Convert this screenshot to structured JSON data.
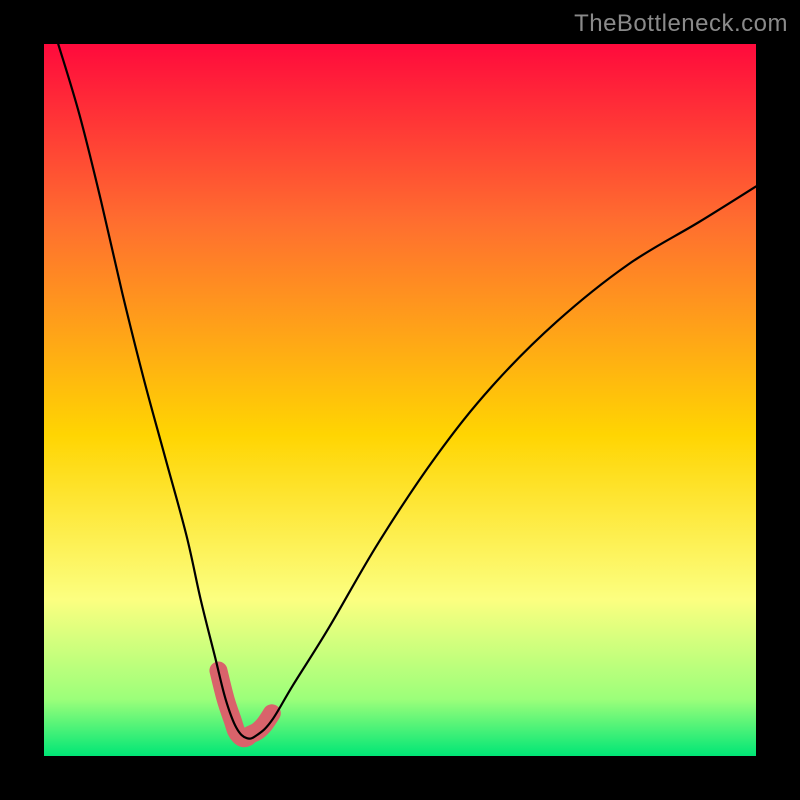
{
  "watermark": "TheBottleneck.com",
  "colors": {
    "frame": "#000000",
    "gradient_top": "#FF0A3C",
    "gradient_mid1": "#FF6E2F",
    "gradient_mid2": "#FFD502",
    "gradient_mid3": "#FCFF80",
    "gradient_bottom1": "#9CFF7A",
    "gradient_bottom2": "#00E676",
    "curve": "#000000",
    "accent": "#D9636B"
  },
  "chart_data": {
    "type": "line",
    "title": "",
    "xlabel": "",
    "ylabel": "",
    "xlim": [
      0,
      100
    ],
    "ylim": [
      0,
      100
    ],
    "categories_note": "continuous x from 0 to 100; axes unlabeled",
    "series": [
      {
        "name": "bottleneck-curve",
        "x": [
          2,
          5,
          8,
          11,
          14,
          17,
          20,
          22,
          24,
          25.5,
          27,
          28.5,
          30,
          32,
          35,
          40,
          47,
          55,
          63,
          72,
          82,
          92,
          100
        ],
        "values": [
          100,
          90,
          78,
          65,
          53,
          42,
          31,
          22,
          14,
          8,
          4,
          2.5,
          3,
          5,
          10,
          18,
          30,
          42,
          52,
          61,
          69,
          75,
          80
        ]
      }
    ],
    "accent_region": {
      "name": "highlighted-minimum",
      "x": [
        24.5,
        25.5,
        26.5,
        27,
        27.5,
        28,
        28.5,
        29,
        30,
        31,
        32
      ],
      "values": [
        12,
        8,
        5,
        3.5,
        2.8,
        2.5,
        2.6,
        3,
        3.5,
        4.5,
        6
      ]
    }
  }
}
